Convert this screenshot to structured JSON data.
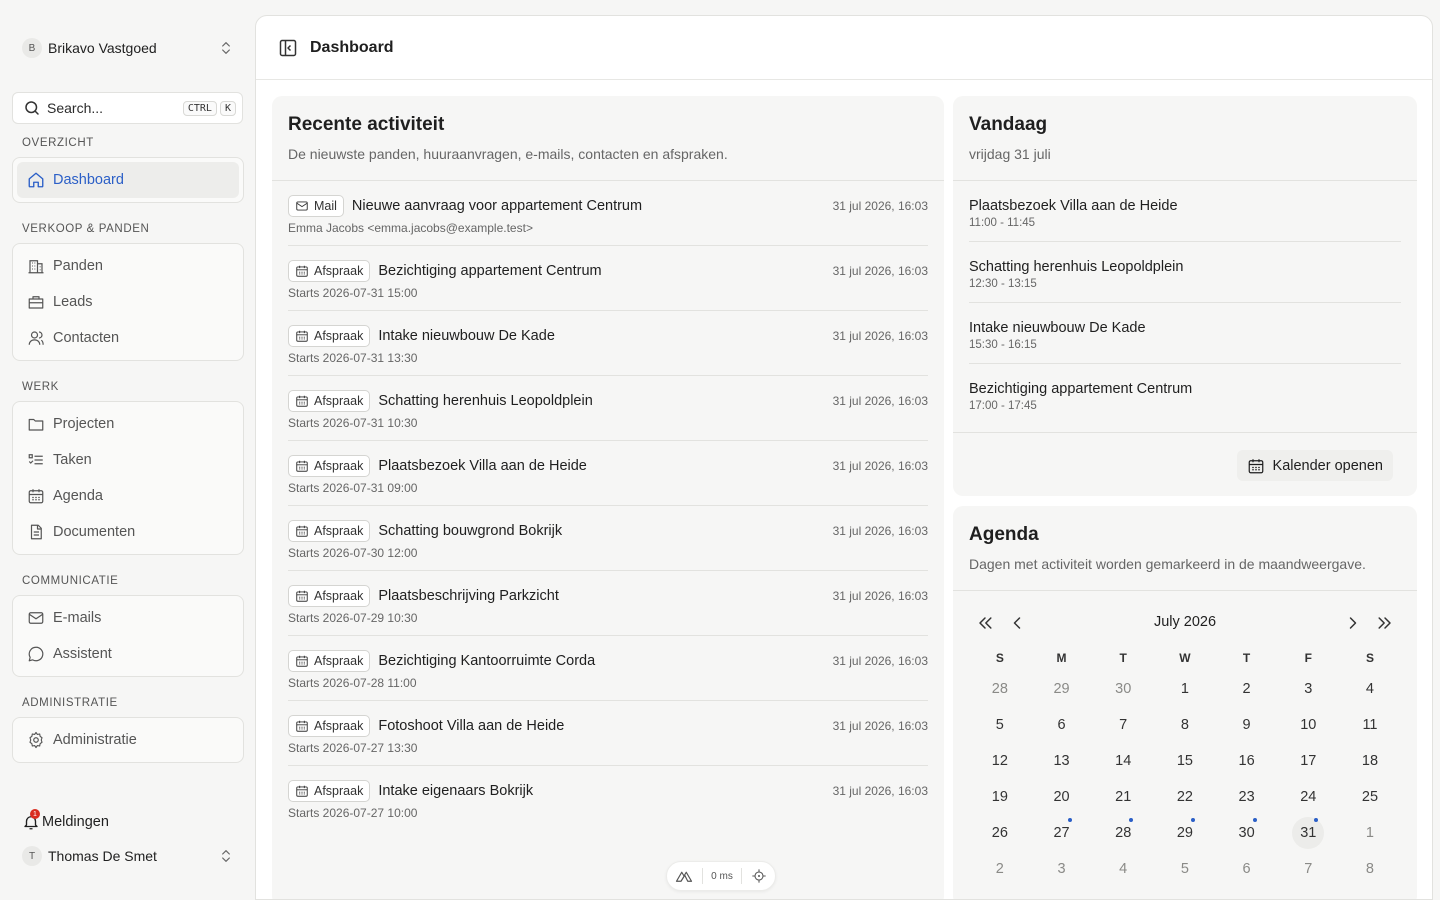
{
  "workspace": {
    "initial": "B",
    "name": "Brikavo Vastgoed"
  },
  "search": {
    "placeholder": "Search...",
    "key1": "CTRL",
    "key2": "K"
  },
  "groups": [
    {
      "label": "OVERZICHT",
      "items": [
        {
          "label": "Dashboard",
          "icon": "home-icon",
          "active": true
        }
      ]
    },
    {
      "label": "VERKOOP & PANDEN",
      "items": [
        {
          "label": "Panden",
          "icon": "building-icon"
        },
        {
          "label": "Leads",
          "icon": "briefcase-icon"
        },
        {
          "label": "Contacten",
          "icon": "users-icon"
        }
      ]
    },
    {
      "label": "WERK",
      "items": [
        {
          "label": "Projecten",
          "icon": "folder-icon"
        },
        {
          "label": "Taken",
          "icon": "list-check-icon"
        },
        {
          "label": "Agenda",
          "icon": "calendar-icon"
        },
        {
          "label": "Documenten",
          "icon": "document-icon"
        }
      ]
    },
    {
      "label": "COMMUNICATIE",
      "items": [
        {
          "label": "E-mails",
          "icon": "mail-icon"
        },
        {
          "label": "Assistent",
          "icon": "chat-icon"
        }
      ]
    },
    {
      "label": "ADMINISTRATIE",
      "items": [
        {
          "label": "Administratie",
          "icon": "gear-icon"
        }
      ]
    }
  ],
  "notifications": {
    "label": "Meldingen",
    "count": "1"
  },
  "user": {
    "initial": "T",
    "name": "Thomas De Smet"
  },
  "header": {
    "title": "Dashboard"
  },
  "activity": {
    "title": "Recente activiteit",
    "subtitle": "De nieuwste panden, huuraanvragen, e-mails, contacten en afspraken.",
    "items": [
      {
        "type": "Mail",
        "title": "Nieuwe aanvraag voor appartement Centrum",
        "sub": "Emma Jacobs <emma.jacobs@example.test>",
        "time": "31 jul 2026, 16:03"
      },
      {
        "type": "Afspraak",
        "title": "Bezichtiging appartement Centrum",
        "sub": "Starts 2026-07-31 15:00",
        "time": "31 jul 2026, 16:03"
      },
      {
        "type": "Afspraak",
        "title": "Intake nieuwbouw De Kade",
        "sub": "Starts 2026-07-31 13:30",
        "time": "31 jul 2026, 16:03"
      },
      {
        "type": "Afspraak",
        "title": "Schatting herenhuis Leopoldplein",
        "sub": "Starts 2026-07-31 10:30",
        "time": "31 jul 2026, 16:03"
      },
      {
        "type": "Afspraak",
        "title": "Plaatsbezoek Villa aan de Heide",
        "sub": "Starts 2026-07-31 09:00",
        "time": "31 jul 2026, 16:03"
      },
      {
        "type": "Afspraak",
        "title": "Schatting bouwgrond Bokrijk",
        "sub": "Starts 2026-07-30 12:00",
        "time": "31 jul 2026, 16:03"
      },
      {
        "type": "Afspraak",
        "title": "Plaatsbeschrijving Parkzicht",
        "sub": "Starts 2026-07-29 10:30",
        "time": "31 jul 2026, 16:03"
      },
      {
        "type": "Afspraak",
        "title": "Bezichtiging Kantoorruimte Corda",
        "sub": "Starts 2026-07-28 11:00",
        "time": "31 jul 2026, 16:03"
      },
      {
        "type": "Afspraak",
        "title": "Fotoshoot Villa aan de Heide",
        "sub": "Starts 2026-07-27 13:30",
        "time": "31 jul 2026, 16:03"
      },
      {
        "type": "Afspraak",
        "title": "Intake eigenaars Bokrijk",
        "sub": "Starts 2026-07-27 10:00",
        "time": "31 jul 2026, 16:03"
      }
    ]
  },
  "today": {
    "title": "Vandaag",
    "subtitle": "vrijdag 31 juli",
    "items": [
      {
        "title": "Plaatsbezoek Villa aan de Heide",
        "time": "11:00 - 11:45"
      },
      {
        "title": "Schatting herenhuis Leopoldplein",
        "time": "12:30 - 13:15"
      },
      {
        "title": "Intake nieuwbouw De Kade",
        "time": "15:30 - 16:15"
      },
      {
        "title": "Bezichtiging appartement Centrum",
        "time": "17:00 - 17:45"
      }
    ],
    "button": "Kalender openen"
  },
  "agenda": {
    "title": "Agenda",
    "subtitle": "Dagen met activiteit worden gemarkeerd in de maandweergave.",
    "month": "July 2026",
    "weekdays": [
      "S",
      "M",
      "T",
      "W",
      "T",
      "F",
      "S"
    ],
    "weeks": [
      [
        {
          "d": "28",
          "m": true
        },
        {
          "d": "29",
          "m": true
        },
        {
          "d": "30",
          "m": true
        },
        {
          "d": "1"
        },
        {
          "d": "2"
        },
        {
          "d": "3"
        },
        {
          "d": "4"
        }
      ],
      [
        {
          "d": "5"
        },
        {
          "d": "6"
        },
        {
          "d": "7"
        },
        {
          "d": "8"
        },
        {
          "d": "9"
        },
        {
          "d": "10"
        },
        {
          "d": "11"
        }
      ],
      [
        {
          "d": "12"
        },
        {
          "d": "13"
        },
        {
          "d": "14"
        },
        {
          "d": "15"
        },
        {
          "d": "16"
        },
        {
          "d": "17"
        },
        {
          "d": "18"
        }
      ],
      [
        {
          "d": "19"
        },
        {
          "d": "20"
        },
        {
          "d": "21"
        },
        {
          "d": "22"
        },
        {
          "d": "23"
        },
        {
          "d": "24"
        },
        {
          "d": "25"
        }
      ],
      [
        {
          "d": "26"
        },
        {
          "d": "27",
          "dot": true
        },
        {
          "d": "28",
          "dot": true
        },
        {
          "d": "29",
          "dot": true
        },
        {
          "d": "30",
          "dot": true
        },
        {
          "d": "31",
          "dot": true,
          "today": true
        },
        {
          "d": "1",
          "m": true
        }
      ],
      [
        {
          "d": "2",
          "m": true
        },
        {
          "d": "3",
          "m": true
        },
        {
          "d": "4",
          "m": true
        },
        {
          "d": "5",
          "m": true
        },
        {
          "d": "6",
          "m": true
        },
        {
          "d": "7",
          "m": true
        },
        {
          "d": "8",
          "m": true
        }
      ]
    ]
  },
  "devtools": {
    "timing": "0 ms"
  },
  "colors": {
    "accent": "#2b5fc7",
    "badge": "#d92d20"
  }
}
